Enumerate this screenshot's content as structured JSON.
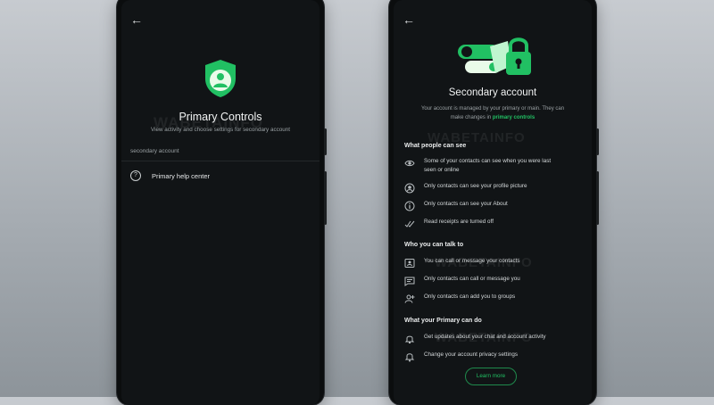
{
  "left_screen": {
    "title": "Primary Controls",
    "subtitle": "View activity and choose settings for secondary account",
    "section_label": "secondary account",
    "help_item": "Primary help center"
  },
  "right_screen": {
    "title": "Secondary account",
    "desc_part1": "Your account is managed by your primary or main. They can",
    "desc_part2": "make changes in",
    "desc_link": "primary controls",
    "section_people": "What people can see",
    "people_items": [
      {
        "icon": "eye-icon",
        "text_line1": "Some of your contacts can see when you were last",
        "text_line2": "seen or online"
      },
      {
        "icon": "profile-icon",
        "text_line1": "Only contacts can see your profile picture",
        "text_line2": ""
      },
      {
        "icon": "info-icon",
        "text_line1": "Only contacts can see your About",
        "text_line2": ""
      },
      {
        "icon": "double-check-icon",
        "text_line1": "Read receipts are turned off",
        "text_line2": ""
      }
    ],
    "section_talk": "Who you can talk to",
    "talk_items": [
      {
        "icon": "contact-card-icon",
        "text": "You can call or message your contacts"
      },
      {
        "icon": "message-icon",
        "text": "Only contacts can call or message you"
      },
      {
        "icon": "add-group-icon",
        "text": "Only contacts can add you to groups"
      }
    ],
    "section_primary": "What your Primary can do",
    "primary_items": [
      {
        "icon": "bell-lock-icon",
        "text": "Get updates about your chat and account activity"
      },
      {
        "icon": "bell-icon",
        "text": "Change your account privacy settings"
      }
    ],
    "learn_more": "Learn more"
  },
  "watermark": "WABETAINFO",
  "colors": {
    "accent": "#21c063",
    "screen_bg": "#111416"
  }
}
